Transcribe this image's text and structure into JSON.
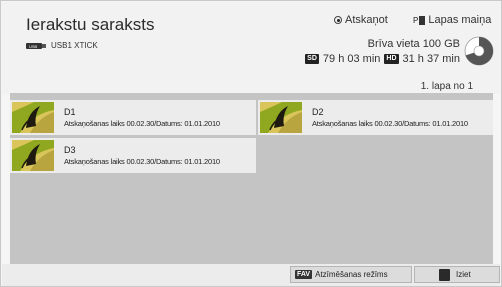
{
  "header": {
    "title": "Ierakstu saraksts",
    "device_label": "USB1 XTICK",
    "device_icon": "usb-icon",
    "play_option": "Atskaņot",
    "page_key_label": "P",
    "page_change": "Lapas maiņa",
    "free_space": "Brīva vieta 100 GB",
    "sd_tag": "SD",
    "sd_time": "79 h 03 min",
    "hd_tag": "HD",
    "hd_time": "31 h 37 min",
    "page_indicator": "1. lapa no 1",
    "disk_used_fraction": 0.7
  },
  "recordings": [
    {
      "name": "D1",
      "meta": "Atskaņošanas laiks 00.02.30/Datums: 01.01.2010"
    },
    {
      "name": "D2",
      "meta": "Atskaņošanas laiks 00.02.30/Datums: 01.01.2010"
    },
    {
      "name": "D3",
      "meta": "Atskaņošanas laiks 00.02.30/Datums: 01.01.2010"
    }
  ],
  "footer": {
    "fav_key": "FAV",
    "fav_label": "Atzīmēšanas režīms",
    "exit_label": "Iziet"
  },
  "colors": {
    "content_bg": "#c4c4c4",
    "item_bg": "#ececec",
    "thumb_leaf": "#8fa81f",
    "thumb_butterfly": "#1e1a10"
  }
}
